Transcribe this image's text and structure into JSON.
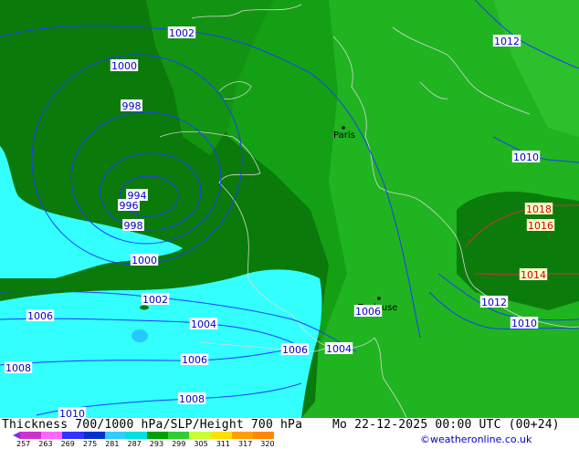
{
  "title": "Thickness 700/1000 hPa/SLP/Height 700 hPa",
  "valid_time": "Mo 22-12-2025 00:00 UTC (00+24)",
  "credit": "©weatheronline.co.uk",
  "city_labels": [
    "Paris",
    "Toulouse"
  ],
  "legend": {
    "ticks": [
      "257",
      "263",
      "269",
      "275",
      "281",
      "287",
      "293",
      "299",
      "305",
      "311",
      "317",
      "320"
    ],
    "colors": [
      "#cc33cc",
      "#ff66ff",
      "#3333ff",
      "#0033cc",
      "#33ccff",
      "#00e0e0",
      "#00a000",
      "#33cc33",
      "#ccff33",
      "#ffe000",
      "#ffa000",
      "#ff8800"
    ]
  },
  "isobar_labels": [
    {
      "text": "1002",
      "color": "#0000c8"
    },
    {
      "text": "1000",
      "color": "#0000c8"
    },
    {
      "text": "998",
      "color": "#0000c8"
    },
    {
      "text": "994",
      "color": "#0000c8"
    },
    {
      "text": "996",
      "color": "#0000c8"
    },
    {
      "text": "998",
      "color": "#0000c8"
    },
    {
      "text": "1000",
      "color": "#0000c8"
    },
    {
      "text": "1002",
      "color": "#0000c8"
    },
    {
      "text": "1004",
      "color": "#0000c8"
    },
    {
      "text": "1006",
      "color": "#0000c8"
    },
    {
      "text": "1006",
      "color": "#0000c8"
    },
    {
      "text": "1008",
      "color": "#0000c8"
    },
    {
      "text": "1006",
      "color": "#0000c8"
    },
    {
      "text": "1008",
      "color": "#0000c8"
    },
    {
      "text": "1010",
      "color": "#0000c8"
    },
    {
      "text": "1004",
      "color": "#0000c8"
    },
    {
      "text": "1006",
      "color": "#0000c8"
    },
    {
      "text": "1012",
      "color": "#0000c8"
    },
    {
      "text": "1010",
      "color": "#0000c8"
    },
    {
      "text": "1012",
      "color": "#0000c8"
    },
    {
      "text": "1010",
      "color": "#0000c8"
    },
    {
      "text": "1018",
      "color": "#cc0000"
    },
    {
      "text": "1016",
      "color": "#cc0000"
    },
    {
      "text": "1014",
      "color": "#cc0000"
    }
  ]
}
